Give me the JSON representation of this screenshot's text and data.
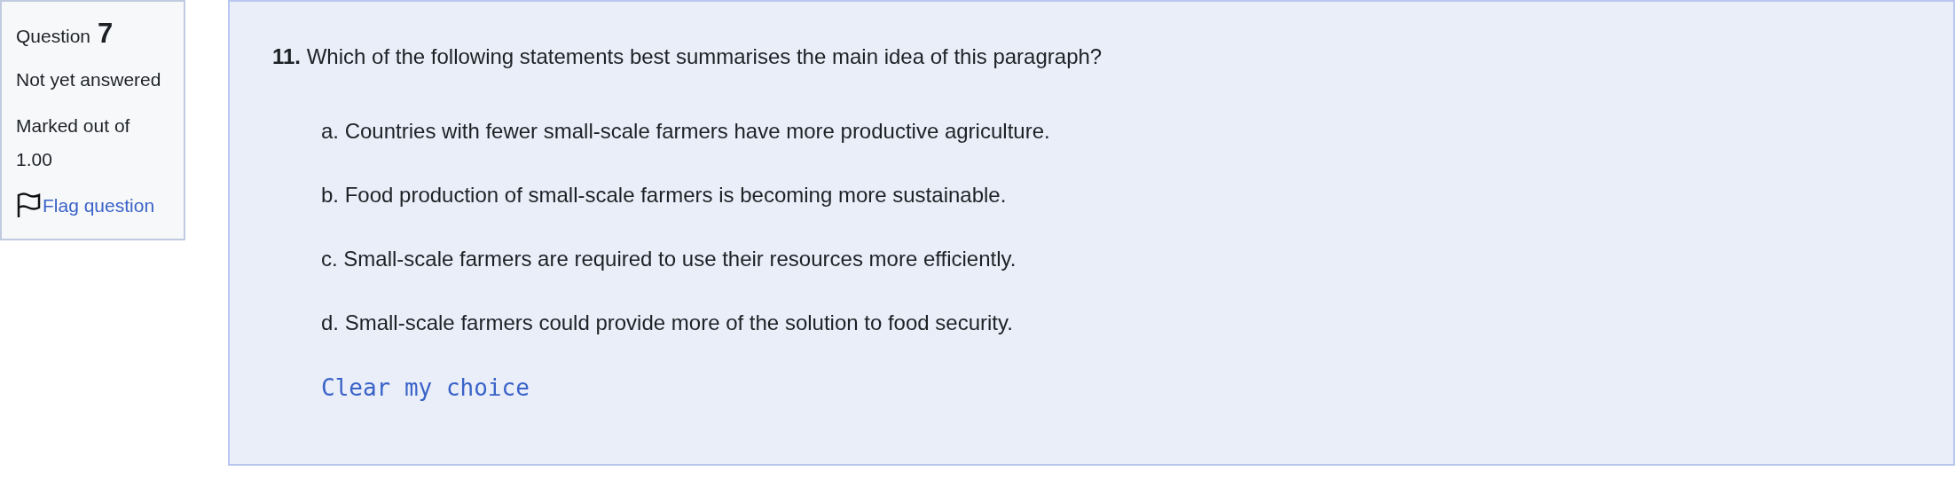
{
  "info": {
    "label": "Question",
    "number": "7",
    "status": "Not yet answered",
    "marks": "Marked out of 1.00",
    "flag": {
      "label": "Flag question",
      "flagged": false
    }
  },
  "question": {
    "number": "11.",
    "text": "Which of the following statements best summarises the main idea of this paragraph?",
    "options": [
      {
        "text": "a. Countries with fewer small-scale farmers have more productive agriculture.",
        "selected": false
      },
      {
        "text": "b. Food production of small-scale farmers is becoming more sustainable.",
        "selected": false
      },
      {
        "text": "c. Small-scale farmers are required to use their resources more efficiently.",
        "selected": false
      },
      {
        "text": "d. Small-scale farmers could provide more of the solution to food security.",
        "selected": false
      }
    ],
    "clear": "Clear my choice"
  }
}
